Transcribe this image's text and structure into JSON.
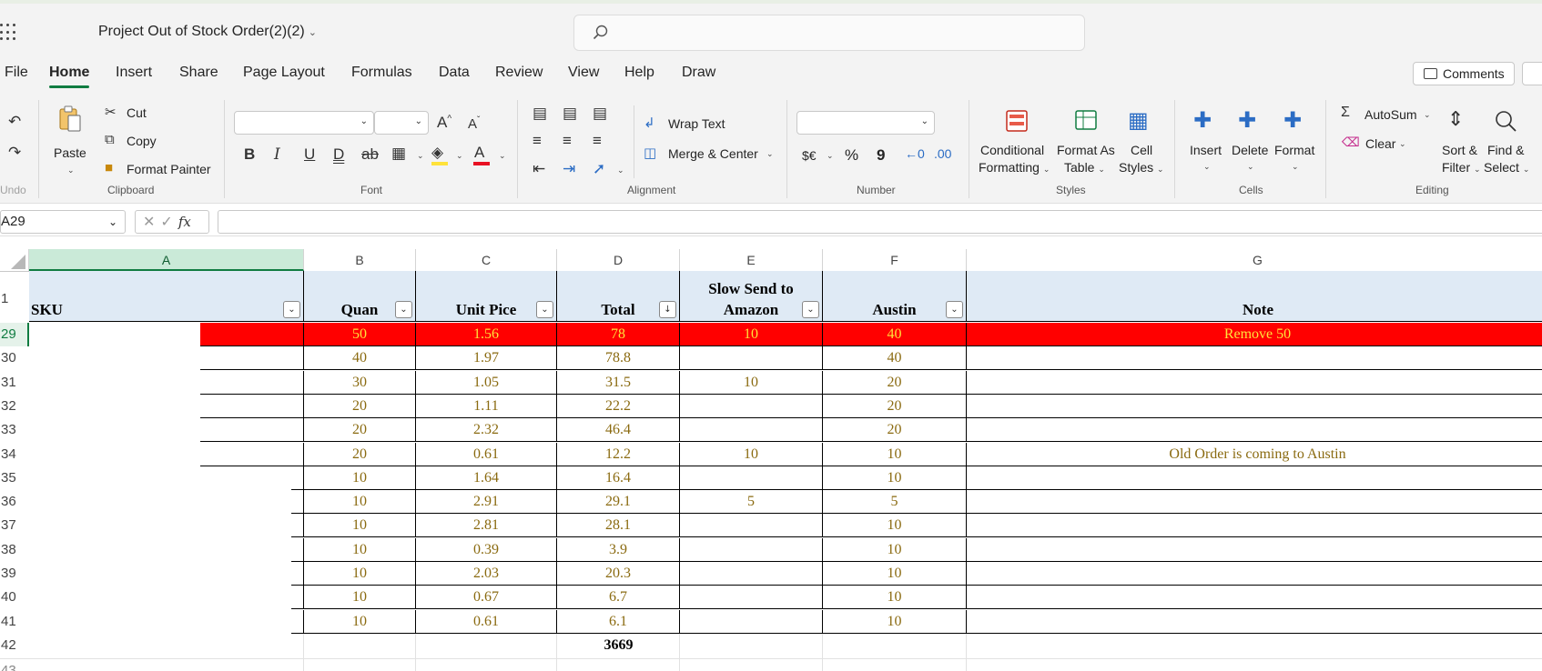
{
  "app": {
    "doc_title": "Project Out of Stock Order(2)(2)",
    "comments_label": "Comments"
  },
  "menu": [
    "File",
    "Home",
    "Insert",
    "Share",
    "Page Layout",
    "Formulas",
    "Data",
    "Review",
    "View",
    "Help",
    "Draw"
  ],
  "ribbon": {
    "undo": {
      "group": "Undo"
    },
    "clipboard": {
      "group": "Clipboard",
      "paste": "Paste",
      "cut": "Cut",
      "copy": "Copy",
      "format_painter": "Format Painter"
    },
    "font": {
      "group": "Font"
    },
    "alignment": {
      "group": "Alignment",
      "wrap_text": "Wrap Text",
      "merge_center": "Merge & Center"
    },
    "number": {
      "group": "Number",
      "currency": "$€",
      "percent": "%",
      "comma": "9"
    },
    "styles": {
      "group": "Styles",
      "conditional": [
        "Conditional",
        "Formatting"
      ],
      "format_table": [
        "Format As",
        "Table"
      ],
      "cell_styles": [
        "Cell",
        "Styles"
      ]
    },
    "cells": {
      "group": "Cells",
      "insert": "Insert",
      "delete": "Delete",
      "format": "Format"
    },
    "editing": {
      "group": "Editing",
      "autosum": "AutoSum",
      "clear": "Clear",
      "sort_filter": [
        "Sort &",
        "Filter"
      ],
      "find_select": [
        "Find &",
        "Select"
      ]
    }
  },
  "formula_bar": {
    "name_box": "A29",
    "fx": "fx",
    "formula": ""
  },
  "sheet": {
    "columns": [
      "A",
      "B",
      "C",
      "D",
      "E",
      "F",
      "G"
    ],
    "header_row_number": "1",
    "headers": {
      "A": "SKU",
      "B": "Quan",
      "C": "Unit Pice",
      "D": "Total",
      "E1": "Slow Send to",
      "E2": "Amazon",
      "F": "Austin",
      "G": "Note"
    },
    "rows": [
      {
        "num": "29",
        "B": "50",
        "C": "1.56",
        "D": "78",
        "E": "10",
        "F": "40",
        "G": "Remove 50"
      },
      {
        "num": "30",
        "B": "40",
        "C": "1.97",
        "D": "78.8",
        "E": "",
        "F": "40",
        "G": ""
      },
      {
        "num": "31",
        "B": "30",
        "C": "1.05",
        "D": "31.5",
        "E": "10",
        "F": "20",
        "G": ""
      },
      {
        "num": "32",
        "B": "20",
        "C": "1.11",
        "D": "22.2",
        "E": "",
        "F": "20",
        "G": ""
      },
      {
        "num": "33",
        "B": "20",
        "C": "2.32",
        "D": "46.4",
        "E": "",
        "F": "20",
        "G": ""
      },
      {
        "num": "34",
        "B": "20",
        "C": "0.61",
        "D": "12.2",
        "E": "10",
        "F": "10",
        "G": "Old Order is coming to Austin"
      },
      {
        "num": "35",
        "B": "10",
        "C": "1.64",
        "D": "16.4",
        "E": "",
        "F": "10",
        "G": ""
      },
      {
        "num": "36",
        "B": "10",
        "C": "2.91",
        "D": "29.1",
        "E": "5",
        "F": "5",
        "G": ""
      },
      {
        "num": "37",
        "B": "10",
        "C": "2.81",
        "D": "28.1",
        "E": "",
        "F": "10",
        "G": ""
      },
      {
        "num": "38",
        "B": "10",
        "C": "0.39",
        "D": "3.9",
        "E": "",
        "F": "10",
        "G": ""
      },
      {
        "num": "39",
        "B": "10",
        "C": "2.03",
        "D": "20.3",
        "E": "",
        "F": "10",
        "G": ""
      },
      {
        "num": "40",
        "B": "10",
        "C": "0.67",
        "D": "6.7",
        "E": "",
        "F": "10",
        "G": ""
      },
      {
        "num": "41",
        "B": "10",
        "C": "0.61",
        "D": "6.1",
        "E": "",
        "F": "10",
        "G": ""
      }
    ],
    "total_row": {
      "num": "42",
      "D": "3669"
    },
    "next_row_num": "43",
    "colors": {
      "highlight_fill": "#ff0000",
      "highlight_text": "#ffe23a",
      "value_text": "#8a6a10",
      "header_fill": "#dfeaf5",
      "accent": "#107c41"
    }
  }
}
